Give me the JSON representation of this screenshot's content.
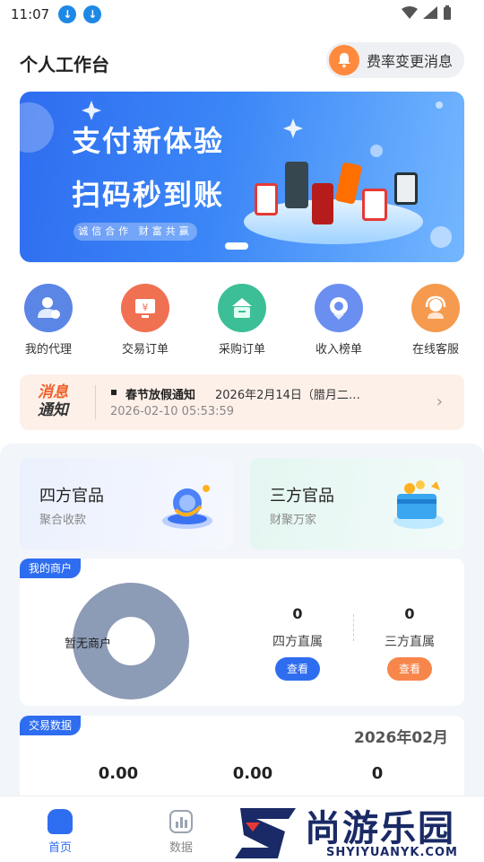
{
  "status_bar": {
    "time": "11:07"
  },
  "header": {
    "title": "个人工作台",
    "rate_button": "费率变更消息"
  },
  "banner": {
    "line1": "支付新体验",
    "line2": "扫码秒到账",
    "slogan": "诚信合作 财富共赢"
  },
  "quick_actions": [
    {
      "label": "我的代理",
      "icon": "agent-icon",
      "color": "#5b86e5"
    },
    {
      "label": "交易订单",
      "icon": "trade-order-icon",
      "color": "#f07052"
    },
    {
      "label": "采购订单",
      "icon": "purchase-order-icon",
      "color": "#3cbf96"
    },
    {
      "label": "收入榜单",
      "icon": "income-rank-icon",
      "color": "#6b8ff0"
    },
    {
      "label": "在线客服",
      "icon": "customer-service-icon",
      "color": "#f59a4e"
    }
  ],
  "notice": {
    "tag_line1": "消息",
    "tag_line2": "通知",
    "title": "春节放假通知",
    "text": "2026年2月14日（腊月二…",
    "time": "2026-02-10 05:53:59"
  },
  "products": [
    {
      "title": "四方官品",
      "subtitle": "聚合收款"
    },
    {
      "title": "三方官品",
      "subtitle": "财聚万家"
    }
  ],
  "merchants": {
    "tag": "我的商户",
    "empty_label": "暂无商户",
    "stats": [
      {
        "value": "0",
        "label": "四方直属",
        "button": "查看",
        "color": "#2f6df0"
      },
      {
        "value": "0",
        "label": "三方直属",
        "button": "查看",
        "color": "#f7864b"
      }
    ]
  },
  "trade": {
    "tag": "交易数据",
    "month": "2026年02月",
    "values": [
      "0.00",
      "0.00",
      "0"
    ]
  },
  "tabbar": {
    "tabs": [
      {
        "label": "首页",
        "active": true
      },
      {
        "label": "数据",
        "active": false
      }
    ]
  },
  "watermark": {
    "text": "尚游乐园",
    "url": "SHYIYUANYK.COM"
  },
  "colors": {
    "primary": "#2f6df0",
    "orange": "#f7864b",
    "donut": "#8c9bb6"
  }
}
